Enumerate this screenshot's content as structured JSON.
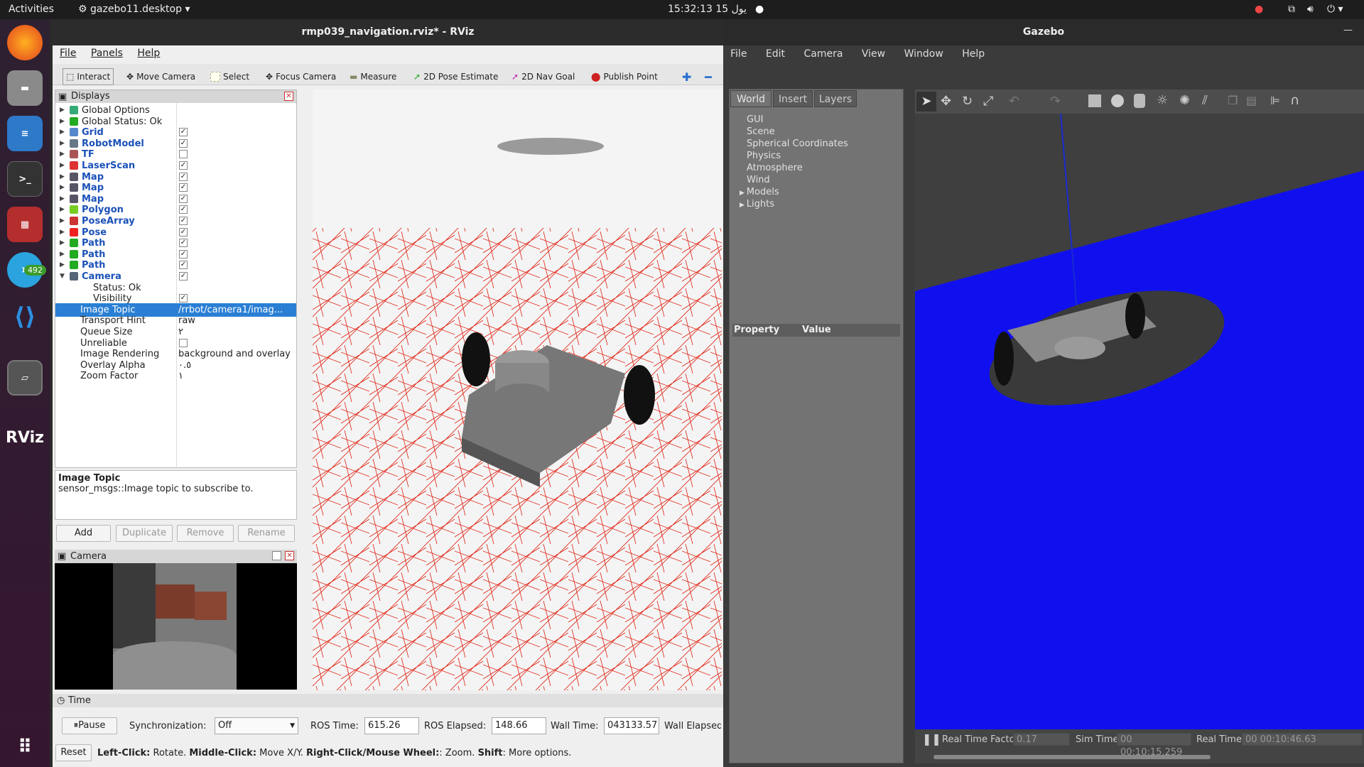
{
  "topbar": {
    "activities": "Activities",
    "app": "gazebo11.desktop",
    "clock": "15:32:13 15 يول"
  },
  "dock": {
    "telegram_badge": "492"
  },
  "rviz": {
    "title": "rmp039_navigation.rviz* - RViz",
    "menu": [
      "File",
      "Panels",
      "Help"
    ],
    "tools": [
      "Interact",
      "Move Camera",
      "Select",
      "Focus Camera",
      "Measure",
      "2D Pose Estimate",
      "2D Nav Goal",
      "Publish Point"
    ],
    "displays_title": "Displays",
    "tree": [
      {
        "label": "Global Options",
        "kind": "opt"
      },
      {
        "label": "Global Status: Ok",
        "kind": "status"
      },
      {
        "label": "Grid",
        "kind": "disp",
        "checked": true
      },
      {
        "label": "RobotModel",
        "kind": "disp",
        "checked": true
      },
      {
        "label": "TF",
        "kind": "disp",
        "checked": false
      },
      {
        "label": "LaserScan",
        "kind": "disp",
        "checked": true
      },
      {
        "label": "Map",
        "kind": "disp",
        "checked": true
      },
      {
        "label": "Map",
        "kind": "disp",
        "checked": true
      },
      {
        "label": "Map",
        "kind": "disp",
        "checked": true
      },
      {
        "label": "Polygon",
        "kind": "disp",
        "checked": true
      },
      {
        "label": "PoseArray",
        "kind": "disp",
        "checked": true
      },
      {
        "label": "Pose",
        "kind": "disp",
        "checked": true
      },
      {
        "label": "Path",
        "kind": "disp",
        "checked": true
      },
      {
        "label": "Path",
        "kind": "disp",
        "checked": true
      },
      {
        "label": "Path",
        "kind": "disp",
        "checked": true
      },
      {
        "label": "Camera",
        "kind": "disp",
        "checked": true
      }
    ],
    "camera_props": [
      {
        "label": "Status: Ok",
        "value": ""
      },
      {
        "label": "Visibility",
        "value": "✓"
      },
      {
        "label": "Image Topic",
        "value": "/rrbot/camera1/imag..."
      },
      {
        "label": "Transport Hint",
        "value": "raw"
      },
      {
        "label": "Queue Size",
        "value": "٢"
      },
      {
        "label": "Unreliable",
        "value": ""
      },
      {
        "label": "Image Rendering",
        "value": "background and overlay"
      },
      {
        "label": "Overlay Alpha",
        "value": "٠.٥"
      },
      {
        "label": "Zoom Factor",
        "value": "١"
      }
    ],
    "desc_title": "Image Topic",
    "desc_text": "sensor_msgs::Image topic to subscribe to.",
    "buttons": [
      "Add",
      "Duplicate",
      "Remove",
      "Rename"
    ],
    "camera_panel": "Camera",
    "time_panel": "Time",
    "pause": "Pause",
    "sync_label": "Synchronization:",
    "sync_value": "Off",
    "ros_time_label": "ROS Time:",
    "ros_time": "615.26",
    "ros_elapsed_label": "ROS Elapsed:",
    "ros_elapsed": "148.66",
    "wall_time_label": "Wall Time:",
    "wall_time": "043133.57",
    "wall_elapsed_label": "Wall Elapsed",
    "reset": "Reset",
    "hint": {
      "b1": "Left-Click:",
      "t1": " Rotate. ",
      "b2": "Middle-Click:",
      "t2": " Move X/Y. ",
      "b3": "Right-Click/Mouse Wheel:",
      "t3": ": Zoom. ",
      "b4": "Shift",
      "t4": ": More options."
    }
  },
  "gazebo": {
    "title": "Gazebo",
    "menu": [
      "File",
      "Edit",
      "Camera",
      "View",
      "Window",
      "Help"
    ],
    "tabs": [
      "World",
      "Insert",
      "Layers"
    ],
    "tree": [
      "GUI",
      "Scene",
      "Spherical Coordinates",
      "Physics",
      "Atmosphere",
      "Wind",
      "Models",
      "Lights"
    ],
    "prop_header": "Property",
    "value_header": "Value",
    "rtf_label": "Real Time Factor:",
    "rtf": "0.17",
    "sim_label": "Sim Time:",
    "sim": "00 00:10:15.259",
    "real_label": "Real Time:",
    "real": "00 00:10:46.63"
  }
}
